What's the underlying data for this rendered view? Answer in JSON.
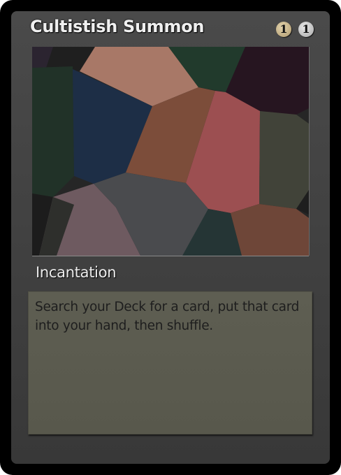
{
  "card": {
    "name": "Cultistish Summon",
    "cost": [
      "1",
      "1"
    ],
    "type_line": "Incantation",
    "rules_text": "Search your Deck for a card, put that card into your hand, then shuffle.",
    "colors": {
      "frame": "#444444",
      "text_box": "#5b5b4f",
      "cost_tan": "#c8b68a",
      "cost_gray": "#c8c8c8"
    }
  }
}
